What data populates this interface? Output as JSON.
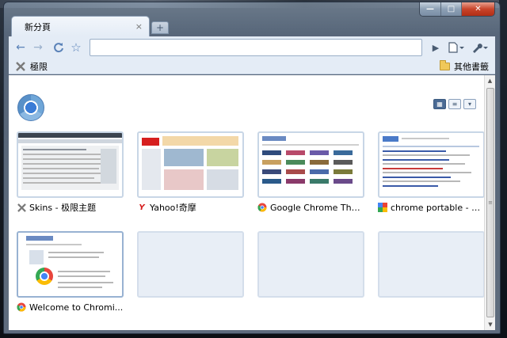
{
  "tab": {
    "title": "新分頁",
    "close": "×",
    "new_tab": "+"
  },
  "caption": {
    "minimize": "—",
    "maximize": "□",
    "close": "✕"
  },
  "toolbar": {
    "back": "←",
    "forward": "→",
    "reload": "C",
    "star": "☆",
    "omnibox_value": "",
    "go": "▶",
    "page_menu": "▭▾",
    "wrench_menu": "🔧▾"
  },
  "bookmarks": {
    "left_item": "極限",
    "other": "其他書籤"
  },
  "view_toggles": [
    "▦",
    "≡",
    "▾"
  ],
  "thumbnails": [
    {
      "title": "Skins - 极限主题",
      "favicon": "x-favicon",
      "empty": false
    },
    {
      "title": "Yahoo!奇摩",
      "favicon": "yahoo-favicon",
      "favicon_glyph": "Y",
      "empty": false
    },
    {
      "title": "Google Chrome The...",
      "favicon": "chrome-favicon",
      "empty": false
    },
    {
      "title": "chrome portable - G...",
      "favicon": "google-favicon",
      "empty": false
    },
    {
      "title": "Welcome to Chromi...",
      "favicon": "chrome-favicon",
      "empty": false
    },
    {
      "title": "",
      "empty": true
    },
    {
      "title": "",
      "empty": true
    },
    {
      "title": "",
      "empty": true
    }
  ],
  "colors": {
    "accent": "#4a6a94",
    "chrome_frame": "#e4ecf6",
    "yahoo_red": "#d61f1f"
  }
}
